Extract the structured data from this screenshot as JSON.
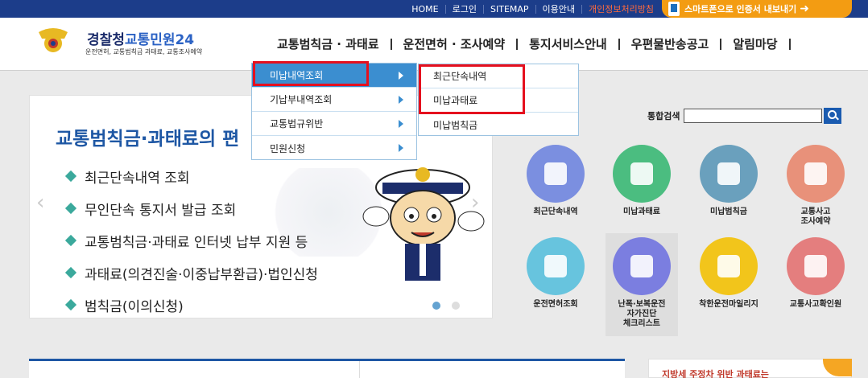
{
  "topbar": {
    "links": [
      "HOME",
      "로그인",
      "SITEMAP",
      "이용안내",
      "개인정보처리방침"
    ],
    "smart_btn": "스마트폰으로 인증서 내보내기"
  },
  "logo": {
    "title_a": "경찰청",
    "title_b": "교통민원24",
    "subtitle": "운전면허, 교통범칙금 과태료, 교통조사예약"
  },
  "gnb": [
    "교통범칙금 · 과태료",
    "운전면허 · 조사예약",
    "통지서비스안내",
    "우편물반송공고",
    "알림마당"
  ],
  "submenu1": [
    "미납내역조회",
    "기납부내역조회",
    "교통법규위반",
    "민원신청"
  ],
  "submenu2": [
    "최근단속내역",
    "미납과태료",
    "미납범칙금"
  ],
  "main": {
    "title": "교통범칙금·과태료의 편",
    "bullets": [
      "최근단속내역 조회",
      "무인단속 통지서 발급 조회",
      "교통범칙금·과태료 인터넷 납부 지원 등",
      "과태료(의견진술·이중납부환급)·법인신청",
      "범칙금(이의신청)"
    ]
  },
  "search": {
    "label": "통합검색",
    "value": ""
  },
  "services": [
    {
      "label": "최근단속내역",
      "color": "#7b8fe0"
    },
    {
      "label": "미납과태료",
      "color": "#4bbd80"
    },
    {
      "label": "미납범칙금",
      "color": "#6aa0bd"
    },
    {
      "label": "교통사고\n조사예약",
      "color": "#e8917a"
    },
    {
      "label": "운전면허조회",
      "color": "#67c4de"
    },
    {
      "label": "난폭·보복운전\n자가진단\n체크리스트",
      "color": "#7b7ee0"
    },
    {
      "label": "착한운전마일리지",
      "color": "#f2c51b"
    },
    {
      "label": "교통사고확인원",
      "color": "#e47e7e"
    }
  ],
  "notice": {
    "text": "지방세 주정차 위반 과태료는"
  }
}
